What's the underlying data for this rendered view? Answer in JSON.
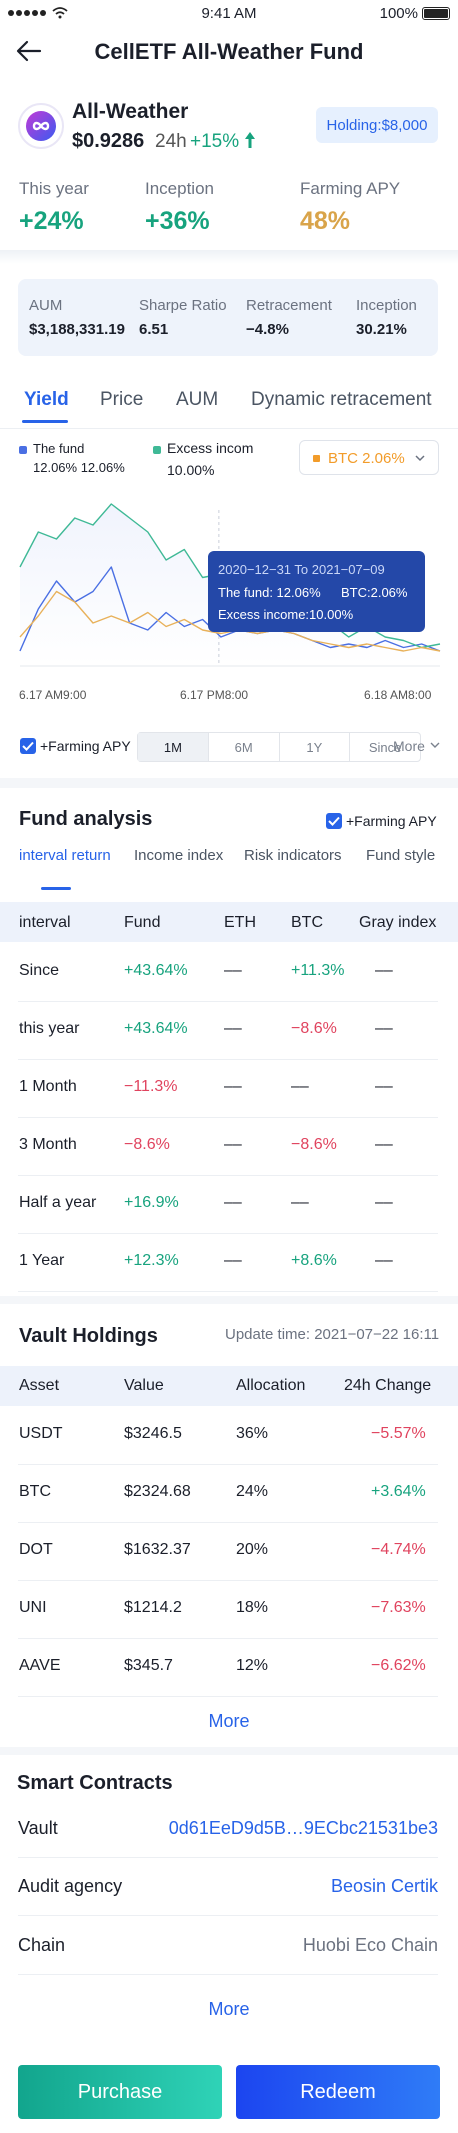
{
  "status_bar": {
    "time": "9:41 AM",
    "battery": "100%"
  },
  "header": {
    "title": "CellETF All-Weather Fund"
  },
  "fund": {
    "name": "All-Weather",
    "price": "$0.9286",
    "h24_label": "24h",
    "h24_change": "+15%",
    "holding": "Holding:$8,000"
  },
  "stats": [
    {
      "label": "This year",
      "value": "+24%",
      "color": "#17a37e"
    },
    {
      "label": "Inception",
      "value": "+36%",
      "color": "#17a37e"
    },
    {
      "label": "Farming APY",
      "value": "48%",
      "color": "#d9a44a"
    }
  ],
  "metrics": [
    {
      "label": "AUM",
      "value": "$3,188,331.19"
    },
    {
      "label": "Sharpe Ratio",
      "value": "6.51"
    },
    {
      "label": "Retracement",
      "value": "−4.8%"
    },
    {
      "label": "Inception",
      "value": "30.21%"
    }
  ],
  "chart_tabs": [
    "Yield",
    "Price",
    "AUM",
    "Dynamic retracement"
  ],
  "legend": {
    "fund_label": "The fund",
    "fund_values": "12.06% 12.06%",
    "excess_label": "Excess incom",
    "excess_value": "10.00%",
    "compare": "BTC 2.06%"
  },
  "tooltip": {
    "range": "2020−12−31 To 2021−07−09",
    "fund": "The fund: 12.06%",
    "btc": "BTC:2.06%",
    "excess": "Excess income:10.00%"
  },
  "x_axis": [
    "6.17  AM9:00",
    "6.17  PM8:00",
    "6.18  AM8:00"
  ],
  "farming_label": "+Farming APY",
  "periods": [
    "1M",
    "6M",
    "1Y",
    "Since"
  ],
  "more_small": "More",
  "chart_data": {
    "type": "line",
    "x": [
      "6.17  AM9:00",
      "",
      "",
      "",
      "",
      "",
      "",
      "",
      "",
      "",
      "",
      "6.17  PM8:00",
      "",
      "",
      "",
      "",
      "",
      "",
      "",
      "",
      "",
      "",
      "",
      "6.18  AM8:00"
    ],
    "series": [
      {
        "name": "The fund",
        "color": "#4a6fe3",
        "values": [
          2,
          8,
          12,
          9,
          10.5,
          14,
          6,
          5,
          7.5,
          5.5,
          6.5,
          4,
          5,
          4.5,
          5,
          4.5,
          3.5,
          2.5,
          3,
          2.5,
          3.5,
          2.5,
          3,
          2
        ]
      },
      {
        "name": "Excess incom",
        "color": "#3fb996",
        "values": [
          14,
          19,
          18,
          21,
          20,
          23,
          21,
          19,
          15,
          16.5,
          12.5,
          13,
          10,
          9.5,
          10,
          9.5,
          8,
          6,
          4,
          5.5,
          4,
          3.5,
          2.5,
          3
        ]
      },
      {
        "name": "BTC",
        "color": "#e8b15a",
        "values": [
          4,
          7,
          10.5,
          9,
          6,
          7,
          6,
          7.5,
          5.5,
          6.5,
          5,
          4.5,
          5,
          4.5,
          5,
          4.5,
          3.5,
          3,
          2.5,
          3,
          2.5,
          2,
          2.5,
          2
        ]
      }
    ],
    "ylim": [
      0,
      25
    ]
  },
  "fund_analysis": {
    "title": "Fund analysis",
    "farming_label": "+Farming APY",
    "tabs": [
      "interval return",
      "Income index",
      "Risk indicators",
      "Fund style"
    ],
    "columns": [
      "interval",
      "Fund",
      "ETH",
      "BTC",
      "Gray index"
    ],
    "rows": [
      {
        "interval": "Since",
        "fund": "+43.64%",
        "eth": "––",
        "btc": "+11.3%",
        "gray": "––"
      },
      {
        "interval": "this year",
        "fund": "+43.64%",
        "eth": "––",
        "btc": "−8.6%",
        "gray": "––"
      },
      {
        "interval": "1 Month",
        "fund": "−11.3%",
        "eth": "––",
        "btc": "––",
        "gray": "––"
      },
      {
        "interval": "3 Month",
        "fund": "−8.6%",
        "eth": "––",
        "btc": "−8.6%",
        "gray": "––"
      },
      {
        "interval": "Half a year",
        "fund": "+16.9%",
        "eth": "––",
        "btc": "––",
        "gray": "––"
      },
      {
        "interval": "1 Year",
        "fund": "+12.3%",
        "eth": "––",
        "btc": "+8.6%",
        "gray": "––"
      }
    ]
  },
  "vault": {
    "title": "Vault Holdings",
    "update": "Update time: 2021−07−22 16:11",
    "columns": [
      "Asset",
      "Value",
      "Allocation",
      "24h Change"
    ],
    "rows": [
      {
        "asset": "USDT",
        "value": "$3246.5",
        "alloc": "36%",
        "change": "−5.57%"
      },
      {
        "asset": "BTC",
        "value": "$2324.68",
        "alloc": "24%",
        "change": "+3.64%"
      },
      {
        "asset": "DOT",
        "value": "$1632.37",
        "alloc": "20%",
        "change": "−4.74%"
      },
      {
        "asset": "UNI",
        "value": "$1214.2",
        "alloc": "18%",
        "change": "−7.63%"
      },
      {
        "asset": "AAVE",
        "value": "$345.7",
        "alloc": "12%",
        "change": "−6.62%"
      }
    ],
    "more": "More"
  },
  "contracts": {
    "title": "Smart Contracts",
    "items": [
      {
        "label": "Vault",
        "value": "0d61EeD9d5B…9ECbc21531be3"
      },
      {
        "label": "Audit agency",
        "value": "Beosin Certik"
      },
      {
        "label": "Chain",
        "value": "Huobi Eco Chain"
      }
    ],
    "more": "More"
  },
  "actions": {
    "purchase": "Purchase",
    "redeem": "Redeem"
  }
}
